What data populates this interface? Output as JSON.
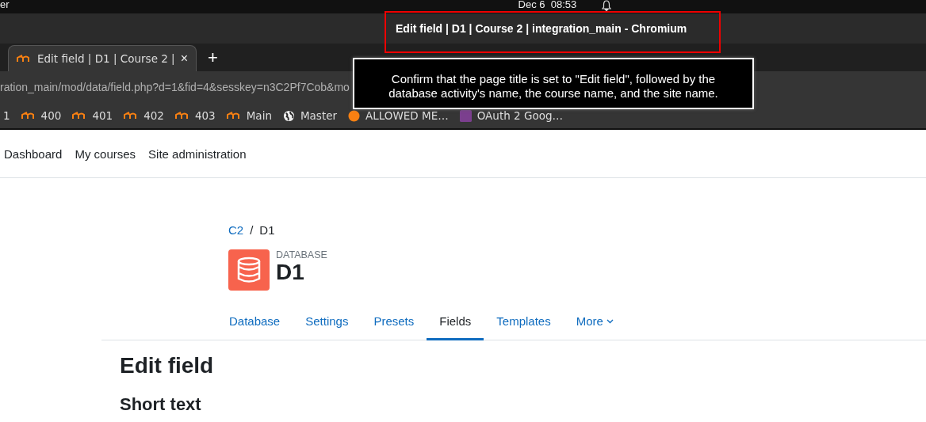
{
  "system_bar": {
    "app": "er",
    "clock": "Dec 6  08:53"
  },
  "window": {
    "title": "Edit field | D1 | Course 2 | integration_main - Chromium"
  },
  "browser_tabs": [
    {
      "label": "Edit field | D1 | Course 2 |",
      "selected": true
    }
  ],
  "new_tab": "+",
  "close_tab": "×",
  "address": "ration_main/mod/data/field.php?d=1&fid=4&sesskey=n3C2Pf7Cob&mo",
  "bookmarks": [
    {
      "label": "1",
      "kind": "none"
    },
    {
      "label": "400",
      "kind": "moodle"
    },
    {
      "label": "401",
      "kind": "moodle"
    },
    {
      "label": "402",
      "kind": "moodle"
    },
    {
      "label": "403",
      "kind": "moodle"
    },
    {
      "label": "Main",
      "kind": "moodle"
    },
    {
      "label": "Master",
      "kind": "globe"
    },
    {
      "label": "ALLOWED ME…",
      "kind": "circle"
    },
    {
      "label": "OAuth 2 Goog…",
      "kind": "square"
    }
  ],
  "tooltip": "Confirm that the page title is set to \"Edit field\", followed by the database activity's name, the course name, and the site name.",
  "nav": [
    "Dashboard",
    "My courses",
    "Site administration"
  ],
  "breadcrumb": [
    {
      "label": "C2",
      "link": true
    },
    {
      "label": "D1",
      "link": false
    }
  ],
  "breadcrumb_separator": "/",
  "activity": {
    "type": "DATABASE",
    "name": "D1"
  },
  "tabs": [
    {
      "label": "Database",
      "selected": false
    },
    {
      "label": "Settings",
      "selected": false
    },
    {
      "label": "Presets",
      "selected": false
    },
    {
      "label": "Fields",
      "selected": true
    },
    {
      "label": "Templates",
      "selected": false
    },
    {
      "label": "More",
      "selected": false,
      "dropdown": true
    }
  ],
  "heading": "Edit field",
  "subheading": "Short text"
}
